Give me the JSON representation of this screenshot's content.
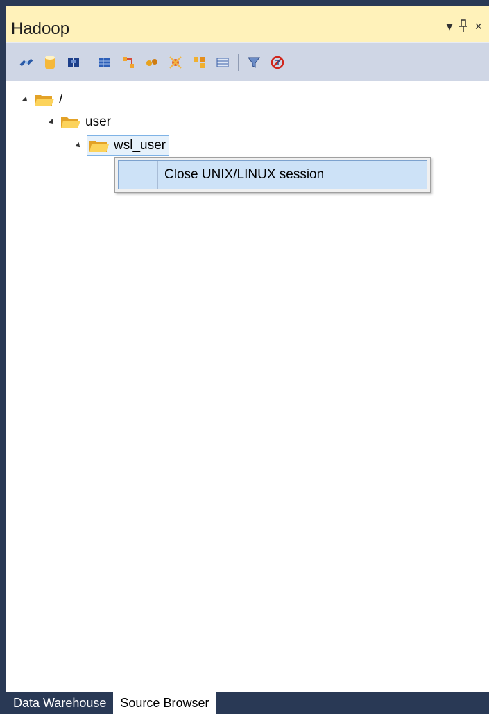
{
  "window": {
    "title": "Hadoop",
    "controls": [
      "▾",
      "⊓",
      "×"
    ]
  },
  "toolbar": {
    "icons": [
      "connect-icon",
      "database-icon",
      "binoculars-icon",
      "table-icon",
      "joins-icon",
      "pattern-icon",
      "schema-icon",
      "network-icon",
      "grid-icon",
      "filter-icon",
      "clear-filter-icon"
    ]
  },
  "tree": {
    "root_label": "/",
    "user_label": "user",
    "wsl_user_label": "wsl_user"
  },
  "context_menu": {
    "item_label": "Close UNIX/LINUX session"
  },
  "tabs": [
    {
      "label": "Data Warehouse"
    },
    {
      "label": "Source Browser"
    }
  ],
  "colors": {
    "titlebar": "#FFF2BA",
    "toolbar": "#CFD6E5",
    "frame": "#293955",
    "selection": "#cde2f7"
  }
}
